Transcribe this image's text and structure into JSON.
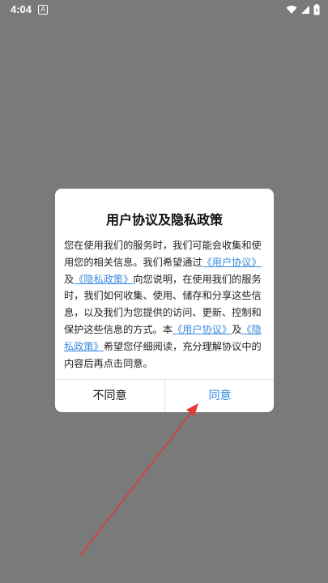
{
  "status_bar": {
    "time": "4:04",
    "notification_icon_text": "A",
    "icons": [
      "wifi-icon",
      "signal-icon",
      "battery-icon"
    ]
  },
  "dialog": {
    "title": "用户协议及隐私政策",
    "body_segments": [
      {
        "text": "您在使用我们的服务时，我们可能会收集和使用您的相关信息。我们希望通过",
        "link": false
      },
      {
        "text": "《用户协议》",
        "link": true
      },
      {
        "text": "及",
        "link": false
      },
      {
        "text": "《隐私政策》",
        "link": true
      },
      {
        "text": "向您说明，在使用我们的服务时，我们如何收集、使用、储存和分享这些信息，以及我们为您提供的访问、更新、控制和保护这些信息的方式。本",
        "link": false
      },
      {
        "text": "《用户协议》",
        "link": true
      },
      {
        "text": "及",
        "link": false
      },
      {
        "text": "《隐私政策》",
        "link": true
      },
      {
        "text": "希望您仔细阅读，充分理解协议中的内容后再点击同意。",
        "link": false
      }
    ],
    "disagree_label": "不同意",
    "agree_label": "同意"
  },
  "colors": {
    "overlay": "#7a7a7a",
    "link": "#3a8be0",
    "agree_button": "#2b86e6",
    "annotation_arrow": "#e53935"
  }
}
